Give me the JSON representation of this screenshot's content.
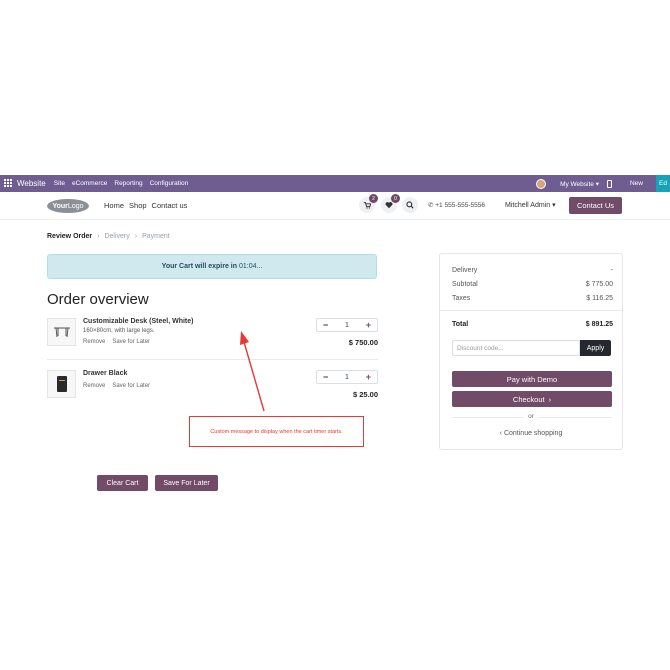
{
  "admin_bar": {
    "brand": "Website",
    "menu": [
      "Site",
      "eCommerce",
      "Reporting",
      "Configuration"
    ],
    "website_selector": "My Website",
    "new_label": "New",
    "edit_label": "Ed",
    "bg_color": "#6f5c91"
  },
  "header": {
    "logo_bold": "Your",
    "logo_rest": "Logo",
    "nav": [
      "Home",
      "Shop",
      "Contact us"
    ],
    "cart_count": "2",
    "wishlist_count": "0",
    "phone": "+1 555-555-5556",
    "user": "Mitchell Admin",
    "contact_button": "Contact Us"
  },
  "steps": {
    "review": "Review Order",
    "delivery": "Delivery",
    "payment": "Payment"
  },
  "timer": {
    "prefix": "Your Cart will expire in",
    "time": "01:04..."
  },
  "overview": {
    "title": "Order overview",
    "items": [
      {
        "name": "Customizable Desk (Steel, White)",
        "description": "160×80cm, with large legs.",
        "remove": "Remove",
        "save": "Save for Later",
        "qty": "1",
        "price": "$ 750.00"
      },
      {
        "name": "Drawer Black",
        "remove": "Remove",
        "save": "Save for Later",
        "qty": "1",
        "price": "$ 25.00"
      }
    ],
    "clear_cart": "Clear Cart",
    "save_for_later": "Save For Later"
  },
  "annotation": {
    "text": "Custom message to display when the cart timer starts.",
    "color": "#e53935"
  },
  "summary": {
    "delivery_label": "Delivery",
    "delivery_value": "-",
    "subtotal_label": "Subtotal",
    "subtotal_value": "$ 775.00",
    "taxes_label": "Taxes",
    "taxes_value": "$ 116.25",
    "total_label": "Total",
    "total_value": "$ 891.25",
    "discount_placeholder": "Discount code...",
    "apply": "Apply",
    "pay_demo": "Pay with Demo",
    "checkout": "Checkout",
    "or": "or",
    "continue": "Continue shopping"
  },
  "colors": {
    "primary": "#714b67",
    "timer_bg": "#cfe9ee"
  }
}
